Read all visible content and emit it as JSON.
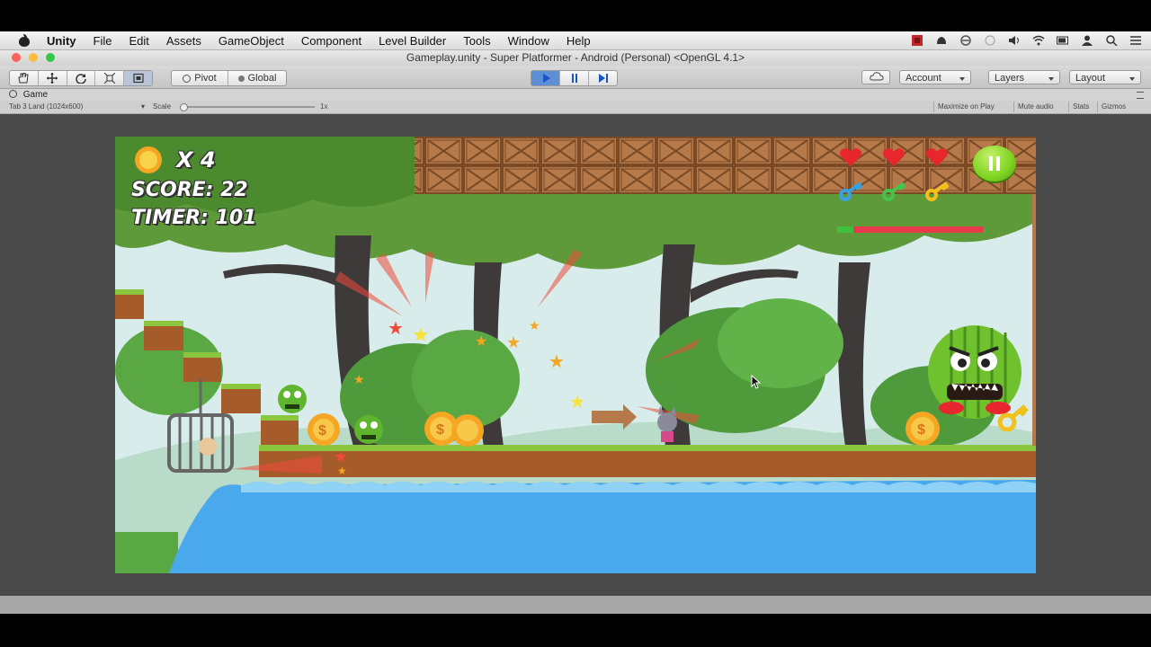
{
  "menubar": {
    "app_name": "Unity",
    "items": [
      "File",
      "Edit",
      "Assets",
      "GameObject",
      "Component",
      "Level Builder",
      "Tools",
      "Window",
      "Help"
    ],
    "status_icons": [
      "record-icon",
      "notification-icon",
      "sync-icon",
      "timemachine-icon",
      "volume-icon",
      "wifi-icon",
      "battery-icon",
      "user-icon",
      "search-icon",
      "list-icon"
    ]
  },
  "window": {
    "title": "Gameplay.unity - Super Platformer - Android (Personal) <OpenGL 4.1>"
  },
  "toolbar": {
    "transform_tools": [
      "hand-icon",
      "move-icon",
      "rotate-icon",
      "scale-icon",
      "rect-icon"
    ],
    "pivot_label": "Pivot",
    "global_label": "Global",
    "playback": [
      "play-icon",
      "pause-icon",
      "step-icon"
    ],
    "cloud_icon": "cloud-icon",
    "account_label": "Account",
    "layers_label": "Layers",
    "layout_label": "Layout"
  },
  "game_view": {
    "tab_label": "Game",
    "resolution": "Tab 3 Land (1024x600)",
    "scale_label": "Scale",
    "scale_value": "1x",
    "maximize_label": "Maximize on Play",
    "mute_label": "Mute audio",
    "stats_label": "Stats",
    "gizmos_label": "Gizmos"
  },
  "hud": {
    "coins": "X 4",
    "score": "SCORE: 22",
    "timer": "TIMER: 101",
    "hearts": 3,
    "keys": [
      "#3aa0e0",
      "#47c24a",
      "#f2c01b"
    ],
    "boss_health": 0.11
  },
  "colors": {
    "sky": "#d8ecec",
    "grass": "#8cc63f",
    "dirt": "#a55b2a",
    "water": "#4aa8ec",
    "crate": "#b67a4a",
    "heart": "#e8262e",
    "pause_button": "#7ed321"
  }
}
